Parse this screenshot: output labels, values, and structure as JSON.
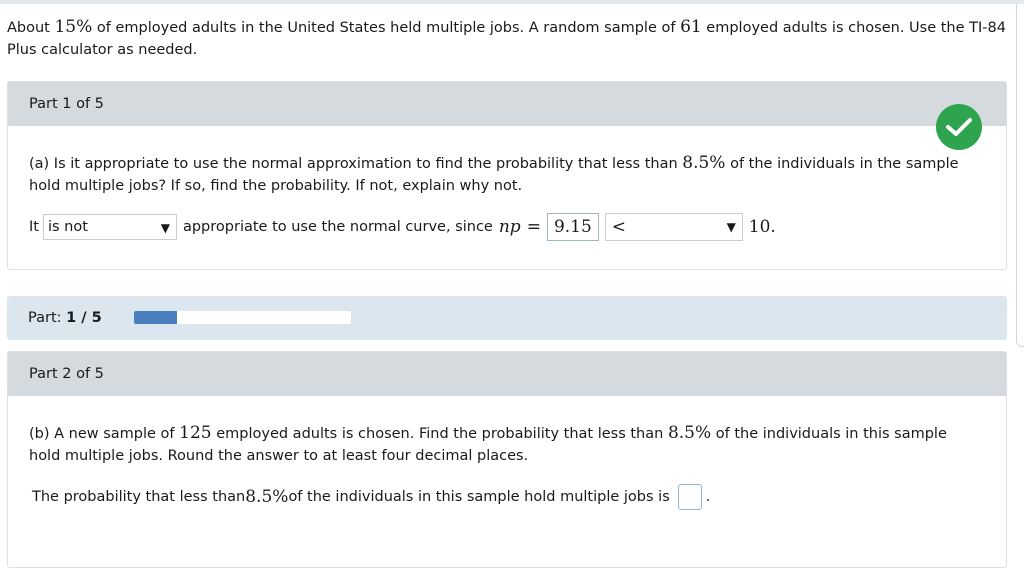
{
  "intro": {
    "t1": "About ",
    "pct": "15%",
    "t2": " of employed adults in the United States held multiple jobs. A random sample of ",
    "n": "61",
    "t3": " employed adults is chosen. Use the TI-84 Plus calculator as needed."
  },
  "part1": {
    "header": "Part 1 of 5",
    "question": {
      "t1": "(a) Is it appropriate to use the normal approximation to find the probability that less than ",
      "pct": "8.5%",
      "t2": " of the individuals in the sample hold multiple jobs? If so, find the probability. If not, explain why not."
    },
    "answer": {
      "prefix": "It",
      "select1_value": "is not",
      "mid": "appropriate to use the normal curve, since",
      "np": "np",
      "eq": "=",
      "np_value": "9.15",
      "select2_value": "<",
      "threshold": "10."
    }
  },
  "progress": {
    "label": "Part:",
    "value": "1 / 5",
    "fraction": 0.2
  },
  "part2": {
    "header": "Part 2 of 5",
    "question": {
      "t1": "(b) A new sample of ",
      "n": "125",
      "t2": " employed adults is chosen. Find the probability that less than ",
      "pct": "8.5%",
      "t3": " of the individuals in this sample hold multiple jobs. Round the answer to at least four decimal places."
    },
    "answer": {
      "t1": "The probability that less than ",
      "pct": "8.5%",
      "t2": " of the individuals in this sample hold multiple jobs is",
      "end": "."
    }
  },
  "icons": {
    "correct": "checkmark-icon",
    "dropdown": "triangle-down-icon"
  },
  "colors": {
    "correct": "#2ea44f",
    "progress_fill": "#4a7fbf",
    "header_bg": "#d5dadf",
    "progress_bg": "#dbe6ef"
  }
}
